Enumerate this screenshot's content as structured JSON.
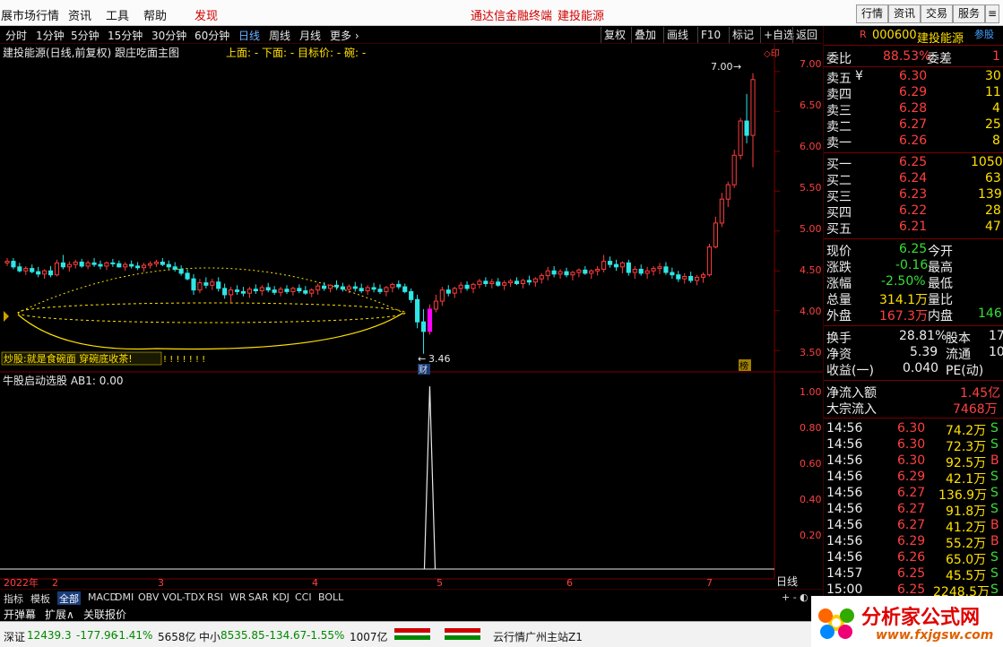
{
  "menubar": {
    "items": [
      "展市场行情",
      "资讯",
      "工具",
      "帮助",
      "发现"
    ],
    "center_title": "通达信金融终端",
    "center_stock": "建投能源",
    "right_buttons": [
      "行情",
      "资讯",
      "交易",
      "服务"
    ]
  },
  "toolbar": {
    "periods": [
      "分时",
      "1分钟",
      "5分钟",
      "15分钟",
      "30分钟",
      "60分钟",
      "日线",
      "周线",
      "月线",
      "更多 ›"
    ],
    "active_period": "日线",
    "right_buttons": [
      "复权",
      "叠加",
      "画线",
      "F10",
      "标记",
      "+自选",
      "返回"
    ]
  },
  "chart": {
    "title": "建投能源(日线,前复权) 跟庄吃面主图",
    "indicator_labels": "上面: - 下面: - 目标价: - 碗: -",
    "y_labels_main": [
      "7.00",
      "6.50",
      "6.00",
      "5.50",
      "5.00",
      "4.50",
      "4.00",
      "3.50"
    ],
    "y_labels_sub": [
      "1.00",
      "0.80",
      "0.60",
      "0.40",
      "0.20"
    ],
    "x_labels": [
      "2022年",
      "2",
      "3",
      "4",
      "5",
      "6",
      "7"
    ],
    "high_annot": "7.00",
    "low_annot": "3.46",
    "annotation_text": "炒股:就是食碗面 穿碗底收茶!",
    "cai_badge": "财",
    "bang_badge": "榜",
    "sub_title": "牛股启动选股 AB1: 0.00",
    "period_label": "日线",
    "corner_controls": "+ - ◐"
  },
  "watermark_text": "xjgsw.Com 分析家公式网www.fxjgsw.Com 分析家公式网www.fxjgsw.Com 分析家公式网www.fxjgsw.Com",
  "chart_data": {
    "type": "candlestick",
    "y_range": [
      3.3,
      7.1
    ],
    "sub_y_range": [
      0,
      1.05
    ],
    "candles": [
      [
        4.6,
        4.66,
        4.56,
        4.62
      ],
      [
        4.62,
        4.66,
        4.52,
        4.55
      ],
      [
        4.55,
        4.6,
        4.48,
        4.5
      ],
      [
        4.5,
        4.56,
        4.45,
        4.53
      ],
      [
        4.53,
        4.58,
        4.47,
        4.49
      ],
      [
        4.49,
        4.55,
        4.42,
        4.46
      ],
      [
        4.46,
        4.52,
        4.4,
        4.5
      ],
      [
        4.5,
        4.56,
        4.42,
        4.45
      ],
      [
        4.45,
        4.64,
        4.43,
        4.6
      ],
      [
        4.6,
        4.7,
        4.52,
        4.55
      ],
      [
        4.55,
        4.62,
        4.49,
        4.58
      ],
      [
        4.58,
        4.64,
        4.53,
        4.61
      ],
      [
        4.61,
        4.65,
        4.54,
        4.56
      ],
      [
        4.56,
        4.63,
        4.52,
        4.6
      ],
      [
        4.6,
        4.66,
        4.55,
        4.58
      ],
      [
        4.58,
        4.63,
        4.52,
        4.56
      ],
      [
        4.56,
        4.62,
        4.51,
        4.6
      ],
      [
        4.6,
        4.65,
        4.55,
        4.59
      ],
      [
        4.59,
        4.63,
        4.54,
        4.55
      ],
      [
        4.55,
        4.61,
        4.5,
        4.58
      ],
      [
        4.58,
        4.63,
        4.53,
        4.56
      ],
      [
        4.56,
        4.61,
        4.51,
        4.54
      ],
      [
        4.54,
        4.6,
        4.49,
        4.57
      ],
      [
        4.57,
        4.62,
        4.53,
        4.59
      ],
      [
        4.59,
        4.64,
        4.55,
        4.61
      ],
      [
        4.61,
        4.66,
        4.56,
        4.58
      ],
      [
        4.58,
        4.63,
        4.52,
        4.55
      ],
      [
        4.55,
        4.61,
        4.49,
        4.52
      ],
      [
        4.52,
        4.57,
        4.44,
        4.47
      ],
      [
        4.47,
        4.52,
        4.38,
        4.4
      ],
      [
        4.4,
        4.46,
        4.2,
        4.26
      ],
      [
        4.26,
        4.4,
        4.22,
        4.35
      ],
      [
        4.35,
        4.42,
        4.28,
        4.32
      ],
      [
        4.32,
        4.4,
        4.26,
        4.36
      ],
      [
        4.36,
        4.42,
        4.24,
        4.28
      ],
      [
        4.28,
        4.34,
        4.15,
        4.2
      ],
      [
        4.2,
        4.3,
        4.1,
        4.26
      ],
      [
        4.26,
        4.32,
        4.2,
        4.24
      ],
      [
        4.24,
        4.3,
        4.18,
        4.22
      ],
      [
        4.22,
        4.3,
        4.16,
        4.27
      ],
      [
        4.27,
        4.33,
        4.21,
        4.25
      ],
      [
        4.25,
        4.32,
        4.19,
        4.29
      ],
      [
        4.29,
        4.35,
        4.23,
        4.26
      ],
      [
        4.26,
        4.31,
        4.2,
        4.23
      ],
      [
        4.23,
        4.3,
        4.18,
        4.27
      ],
      [
        4.27,
        4.32,
        4.21,
        4.24
      ],
      [
        4.24,
        4.3,
        4.19,
        4.28
      ],
      [
        4.28,
        4.33,
        4.22,
        4.25
      ],
      [
        4.25,
        4.31,
        4.2,
        4.22
      ],
      [
        4.22,
        4.28,
        4.17,
        4.26
      ],
      [
        4.26,
        4.34,
        4.2,
        4.31
      ],
      [
        4.31,
        4.36,
        4.25,
        4.28
      ],
      [
        4.28,
        4.33,
        4.23,
        4.32
      ],
      [
        4.32,
        4.38,
        4.26,
        4.3
      ],
      [
        4.3,
        4.35,
        4.24,
        4.27
      ],
      [
        4.27,
        4.33,
        4.22,
        4.3
      ],
      [
        4.3,
        4.36,
        4.24,
        4.28
      ],
      [
        4.28,
        4.34,
        4.22,
        4.25
      ],
      [
        4.25,
        4.32,
        4.2,
        4.29
      ],
      [
        4.29,
        4.35,
        4.23,
        4.27
      ],
      [
        4.27,
        4.33,
        4.21,
        4.24
      ],
      [
        4.24,
        4.31,
        4.18,
        4.29
      ],
      [
        4.29,
        4.35,
        4.23,
        4.33
      ],
      [
        4.33,
        4.38,
        4.27,
        4.3
      ],
      [
        4.3,
        4.34,
        4.22,
        4.24
      ],
      [
        4.24,
        4.28,
        4.1,
        4.14
      ],
      [
        4.14,
        4.2,
        3.78,
        3.86
      ],
      [
        3.86,
        4.02,
        3.46,
        3.74
      ],
      [
        3.74,
        4.08,
        3.7,
        4.02
      ],
      [
        4.02,
        4.2,
        3.98,
        4.12
      ],
      [
        4.12,
        4.3,
        4.06,
        4.26
      ],
      [
        4.26,
        4.32,
        4.18,
        4.22
      ],
      [
        4.22,
        4.3,
        4.16,
        4.28
      ],
      [
        4.28,
        4.36,
        4.22,
        4.32
      ],
      [
        4.32,
        4.37,
        4.25,
        4.28
      ],
      [
        4.28,
        4.35,
        4.22,
        4.33
      ],
      [
        4.33,
        4.4,
        4.28,
        4.37
      ],
      [
        4.37,
        4.42,
        4.3,
        4.34
      ],
      [
        4.34,
        4.4,
        4.28,
        4.36
      ],
      [
        4.36,
        4.41,
        4.3,
        4.32
      ],
      [
        4.32,
        4.38,
        4.26,
        4.35
      ],
      [
        4.35,
        4.4,
        4.3,
        4.37
      ],
      [
        4.37,
        4.42,
        4.32,
        4.34
      ],
      [
        4.34,
        4.4,
        4.28,
        4.38
      ],
      [
        4.38,
        4.44,
        4.32,
        4.36
      ],
      [
        4.36,
        4.42,
        4.3,
        4.4
      ],
      [
        4.4,
        4.47,
        4.34,
        4.44
      ],
      [
        4.44,
        4.55,
        4.38,
        4.5
      ],
      [
        4.5,
        4.56,
        4.42,
        4.46
      ],
      [
        4.46,
        4.52,
        4.4,
        4.49
      ],
      [
        4.49,
        4.54,
        4.42,
        4.45
      ],
      [
        4.45,
        4.5,
        4.38,
        4.48
      ],
      [
        4.48,
        4.53,
        4.42,
        4.51
      ],
      [
        4.51,
        4.56,
        4.45,
        4.47
      ],
      [
        4.47,
        4.52,
        4.4,
        4.5
      ],
      [
        4.5,
        4.56,
        4.44,
        4.52
      ],
      [
        4.52,
        4.7,
        4.48,
        4.62
      ],
      [
        4.62,
        4.68,
        4.54,
        4.58
      ],
      [
        4.58,
        4.64,
        4.5,
        4.55
      ],
      [
        4.55,
        4.62,
        4.47,
        4.6
      ],
      [
        4.6,
        4.64,
        4.44,
        4.48
      ],
      [
        4.48,
        4.56,
        4.4,
        4.52
      ],
      [
        4.52,
        4.58,
        4.44,
        4.47
      ],
      [
        4.47,
        4.55,
        4.4,
        4.5
      ],
      [
        4.5,
        4.56,
        4.44,
        4.53
      ],
      [
        4.53,
        4.6,
        4.46,
        4.55
      ],
      [
        4.55,
        4.61,
        4.45,
        4.48
      ],
      [
        4.48,
        4.54,
        4.4,
        4.45
      ],
      [
        4.45,
        4.5,
        4.36,
        4.4
      ],
      [
        4.4,
        4.47,
        4.34,
        4.43
      ],
      [
        4.43,
        4.49,
        4.35,
        4.38
      ],
      [
        4.38,
        4.45,
        4.32,
        4.42
      ],
      [
        4.42,
        4.48,
        4.35,
        4.45
      ],
      [
        4.45,
        4.84,
        4.43,
        4.8
      ],
      [
        4.8,
        5.18,
        4.78,
        5.1
      ],
      [
        5.1,
        5.48,
        5.05,
        5.4
      ],
      [
        5.4,
        5.62,
        5.3,
        5.58
      ],
      [
        5.58,
        6.02,
        5.54,
        5.95
      ],
      [
        5.95,
        6.42,
        5.9,
        6.38
      ],
      [
        6.38,
        6.72,
        6.1,
        6.2
      ],
      [
        6.2,
        6.98,
        5.8,
        6.9
      ]
    ],
    "sub_signal_index": 68
  },
  "quote": {
    "code": "000600",
    "name": "建投能源",
    "badge": "R",
    "tag": "参股",
    "weibi_label": "委比",
    "weibi_value": "88.53%",
    "weicha_label": "委差",
    "weicha_value": "1",
    "sell": [
      {
        "label": "卖五",
        "mark": "¥",
        "price": "6.30",
        "vol": "30"
      },
      {
        "label": "卖四",
        "mark": "",
        "price": "6.29",
        "vol": "11"
      },
      {
        "label": "卖三",
        "mark": "",
        "price": "6.28",
        "vol": "4"
      },
      {
        "label": "卖二",
        "mark": "",
        "price": "6.27",
        "vol": "25"
      },
      {
        "label": "卖一",
        "mark": "",
        "price": "6.26",
        "vol": "8"
      }
    ],
    "buy": [
      {
        "label": "买一",
        "price": "6.25",
        "vol": "1050"
      },
      {
        "label": "买二",
        "price": "6.24",
        "vol": "63"
      },
      {
        "label": "买三",
        "price": "6.23",
        "vol": "139"
      },
      {
        "label": "买四",
        "price": "6.22",
        "vol": "28"
      },
      {
        "label": "买五",
        "price": "6.21",
        "vol": "47"
      }
    ],
    "stats": [
      {
        "l1": "现价",
        "v1": "6.25",
        "l2": "今开",
        "v2": ""
      },
      {
        "l1": "涨跌",
        "v1": "-0.16",
        "l2": "最高",
        "v2": ""
      },
      {
        "l1": "涨幅",
        "v1": "-2.50%",
        "l2": "最低",
        "v2": ""
      },
      {
        "l1": "总量",
        "v1": "314.1万",
        "l2": "量比",
        "v2": ""
      },
      {
        "l1": "外盘",
        "v1": "167.3万",
        "l2": "内盘",
        "v2": "146"
      }
    ],
    "stats2": [
      {
        "l1": "换手",
        "v1": "28.81%",
        "l2": "股本",
        "v2": "17"
      },
      {
        "l1": "净资",
        "v1": "5.39",
        "l2": "流通",
        "v2": "10"
      },
      {
        "l1": "收益(一)",
        "v1": "0.040",
        "l2": "PE(动)",
        "v2": ""
      }
    ],
    "flow": [
      {
        "label": "净流入额",
        "value": "1.45亿"
      },
      {
        "label": "大宗流入",
        "value": "7468万"
      }
    ],
    "ticks": [
      {
        "time": "14:56",
        "price": "6.30",
        "vol": "74.2万",
        "side": "S"
      },
      {
        "time": "14:56",
        "price": "6.30",
        "vol": "72.3万",
        "side": "S"
      },
      {
        "time": "14:56",
        "price": "6.30",
        "vol": "92.5万",
        "side": "B"
      },
      {
        "time": "14:56",
        "price": "6.29",
        "vol": "42.1万",
        "side": "S"
      },
      {
        "time": "14:56",
        "price": "6.27",
        "vol": "136.9万",
        "side": "S"
      },
      {
        "time": "14:56",
        "price": "6.27",
        "vol": "91.8万",
        "side": "S"
      },
      {
        "time": "14:56",
        "price": "6.27",
        "vol": "41.2万",
        "side": "B"
      },
      {
        "time": "14:56",
        "price": "6.29",
        "vol": "55.2万",
        "side": "B"
      },
      {
        "time": "14:56",
        "price": "6.26",
        "vol": "65.0万",
        "side": "S"
      },
      {
        "time": "14:57",
        "price": "6.25",
        "vol": "45.5万",
        "side": "S"
      },
      {
        "time": "15:00",
        "price": "6.25",
        "vol": "2248.5万",
        "side": "S"
      }
    ]
  },
  "bottom_tabs": [
    "指标",
    "模板",
    "全部",
    "MACD",
    "DMI",
    "OBV",
    "VOL-TDX",
    "RSI",
    "WR",
    "SAR",
    "KDJ",
    "CCI",
    "BOLL"
  ],
  "bottom_active": "全部",
  "bottom_row2": [
    "开弹幕",
    "扩展∧",
    "关联报价"
  ],
  "statusbar": {
    "sz_label": "深证",
    "sz_value": "12439.3",
    "sz_change": "-177.96",
    "sz_pct": "-1.41%",
    "sz_amount": "5658亿",
    "zx_label": "中小",
    "zx_value": "8535.85",
    "zx_change": "-134.67",
    "zx_pct": "-1.55%",
    "zx_amount": "1007亿",
    "server": "云行情广州主站Z1"
  },
  "logo": {
    "name": "分析家公式网",
    "url": "www.fxjgsw.com"
  },
  "colors": {
    "up": "#ff3c3c",
    "down": "#2fe6e6",
    "flat": "#ffffff",
    "accent_yellow": "#ffe000",
    "grid": "#7a0000"
  }
}
